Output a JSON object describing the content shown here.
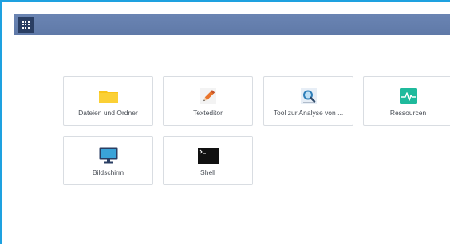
{
  "app": {
    "launcher_icon": "apps-grid-icon"
  },
  "tiles": [
    {
      "label": "Dateien und Ordner",
      "icon": "folder-icon",
      "color": "#f9c51b"
    },
    {
      "label": "Texteditor",
      "icon": "pencil-icon",
      "color": "#e9742b"
    },
    {
      "label": "Tool zur Analyse von ...",
      "icon": "magnifier-icon",
      "color": "#2f7fb9"
    },
    {
      "label": "Ressourcen",
      "icon": "activity-monitor-icon",
      "color": "#1fba9c"
    },
    {
      "label": "Bildschirm",
      "icon": "monitor-icon",
      "color": "#3aa3d8"
    },
    {
      "label": "Shell",
      "icon": "terminal-icon",
      "color": "#111111"
    }
  ],
  "colors": {
    "frame_border": "#1ea1e0",
    "topbar": "#6b85b3",
    "launcher_bg": "#2a3e63"
  }
}
